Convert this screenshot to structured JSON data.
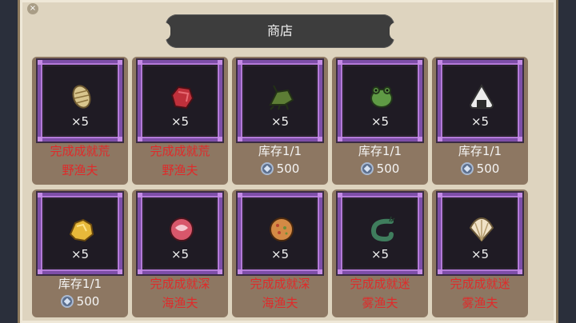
{
  "title": "商店",
  "close_glyph": "×",
  "currency_icon": "coin-icon",
  "cards": [
    {
      "icon": "pinecone-bait-icon",
      "qty": "×5",
      "req_line1": "完成成就荒",
      "req_line2": "野渔夫",
      "stock": "",
      "price": ""
    },
    {
      "icon": "meat-chunk-icon",
      "qty": "×5",
      "req_line1": "完成成就荒",
      "req_line2": "野渔夫",
      "stock": "",
      "price": ""
    },
    {
      "icon": "cricket-icon",
      "qty": "×5",
      "req_line1": "",
      "req_line2": "",
      "stock": "库存1/1",
      "price": "500"
    },
    {
      "icon": "frog-icon",
      "qty": "×5",
      "req_line1": "",
      "req_line2": "",
      "stock": "库存1/1",
      "price": "500"
    },
    {
      "icon": "rice-ball-icon",
      "qty": "×5",
      "req_line1": "",
      "req_line2": "",
      "stock": "库存1/1",
      "price": "500"
    },
    {
      "icon": "gold-nugget-icon",
      "qty": "×5",
      "req_line1": "",
      "req_line2": "",
      "stock": "库存1/1",
      "price": "500"
    },
    {
      "icon": "ham-slice-icon",
      "qty": "×5",
      "req_line1": "完成成就深",
      "req_line2": "海渔夫",
      "stock": "",
      "price": ""
    },
    {
      "icon": "cookie-icon",
      "qty": "×5",
      "req_line1": "完成成就深",
      "req_line2": "海渔夫",
      "stock": "",
      "price": ""
    },
    {
      "icon": "shrimp-icon",
      "qty": "×5",
      "req_line1": "完成成就迷",
      "req_line2": "雾渔夫",
      "stock": "",
      "price": ""
    },
    {
      "icon": "shell-icon",
      "qty": "×5",
      "req_line1": "完成成就迷",
      "req_line2": "雾渔夫",
      "stock": "",
      "price": ""
    }
  ]
}
